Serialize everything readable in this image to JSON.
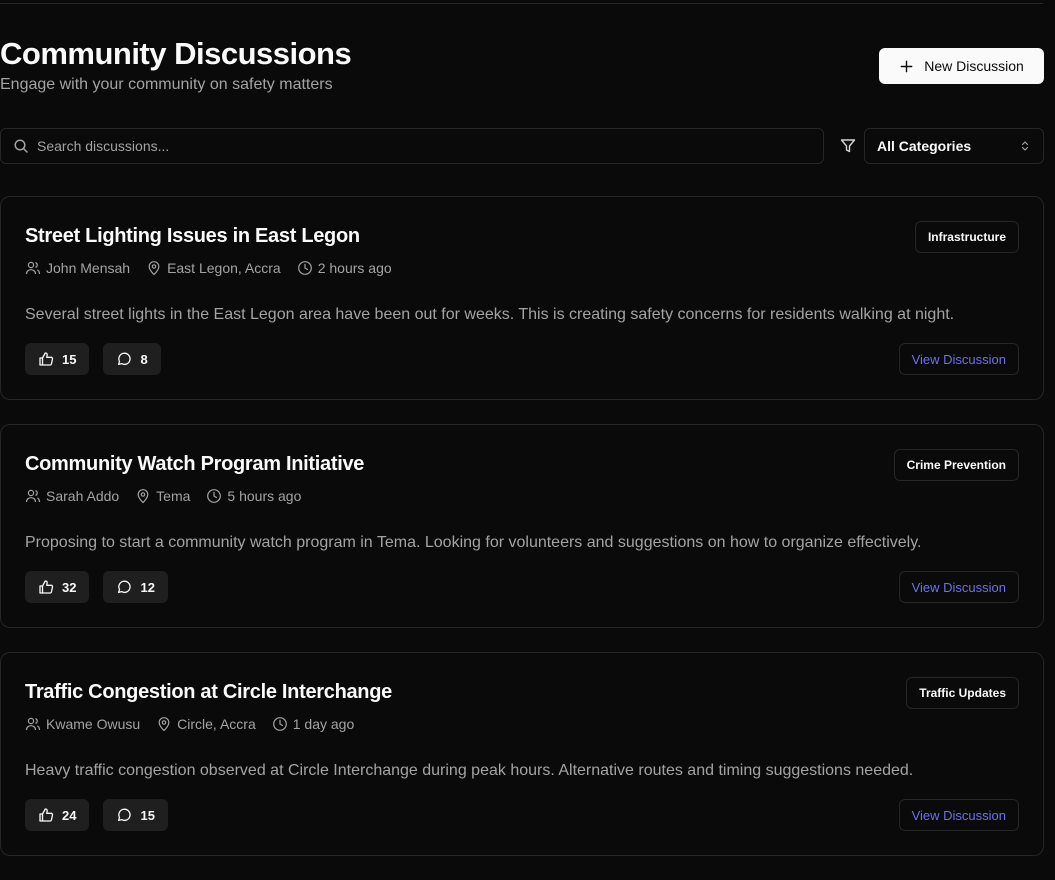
{
  "header": {
    "title": "Community Discussions",
    "subtitle": "Engage with your community on safety matters",
    "new_button_label": "New Discussion"
  },
  "search": {
    "placeholder": "Search discussions...",
    "value": ""
  },
  "filter": {
    "selected_category": "All Categories"
  },
  "discussions": [
    {
      "title": "Street Lighting Issues in East Legon",
      "author": "John Mensah",
      "location": "East Legon, Accra",
      "time": "2 hours ago",
      "category": "Infrastructure",
      "excerpt": "Several street lights in the East Legon area have been out for weeks. This is creating safety concerns for residents walking at night.",
      "likes": "15",
      "comments": "8",
      "view_label": "View Discussion"
    },
    {
      "title": "Community Watch Program Initiative",
      "author": "Sarah Addo",
      "location": "Tema",
      "time": "5 hours ago",
      "category": "Crime Prevention",
      "excerpt": "Proposing to start a community watch program in Tema. Looking for volunteers and suggestions on how to organize effectively.",
      "likes": "32",
      "comments": "12",
      "view_label": "View Discussion"
    },
    {
      "title": "Traffic Congestion at Circle Interchange",
      "author": "Kwame Owusu",
      "location": "Circle, Accra",
      "time": "1 day ago",
      "category": "Traffic Updates",
      "excerpt": "Heavy traffic congestion observed at Circle Interchange during peak hours. Alternative routes and timing suggestions needed.",
      "likes": "24",
      "comments": "15",
      "view_label": "View Discussion"
    }
  ],
  "colors": {
    "background": "#0a0a0a",
    "border": "#262626",
    "muted_text": "#a3a3a3",
    "link_accent": "#6d70ef"
  }
}
